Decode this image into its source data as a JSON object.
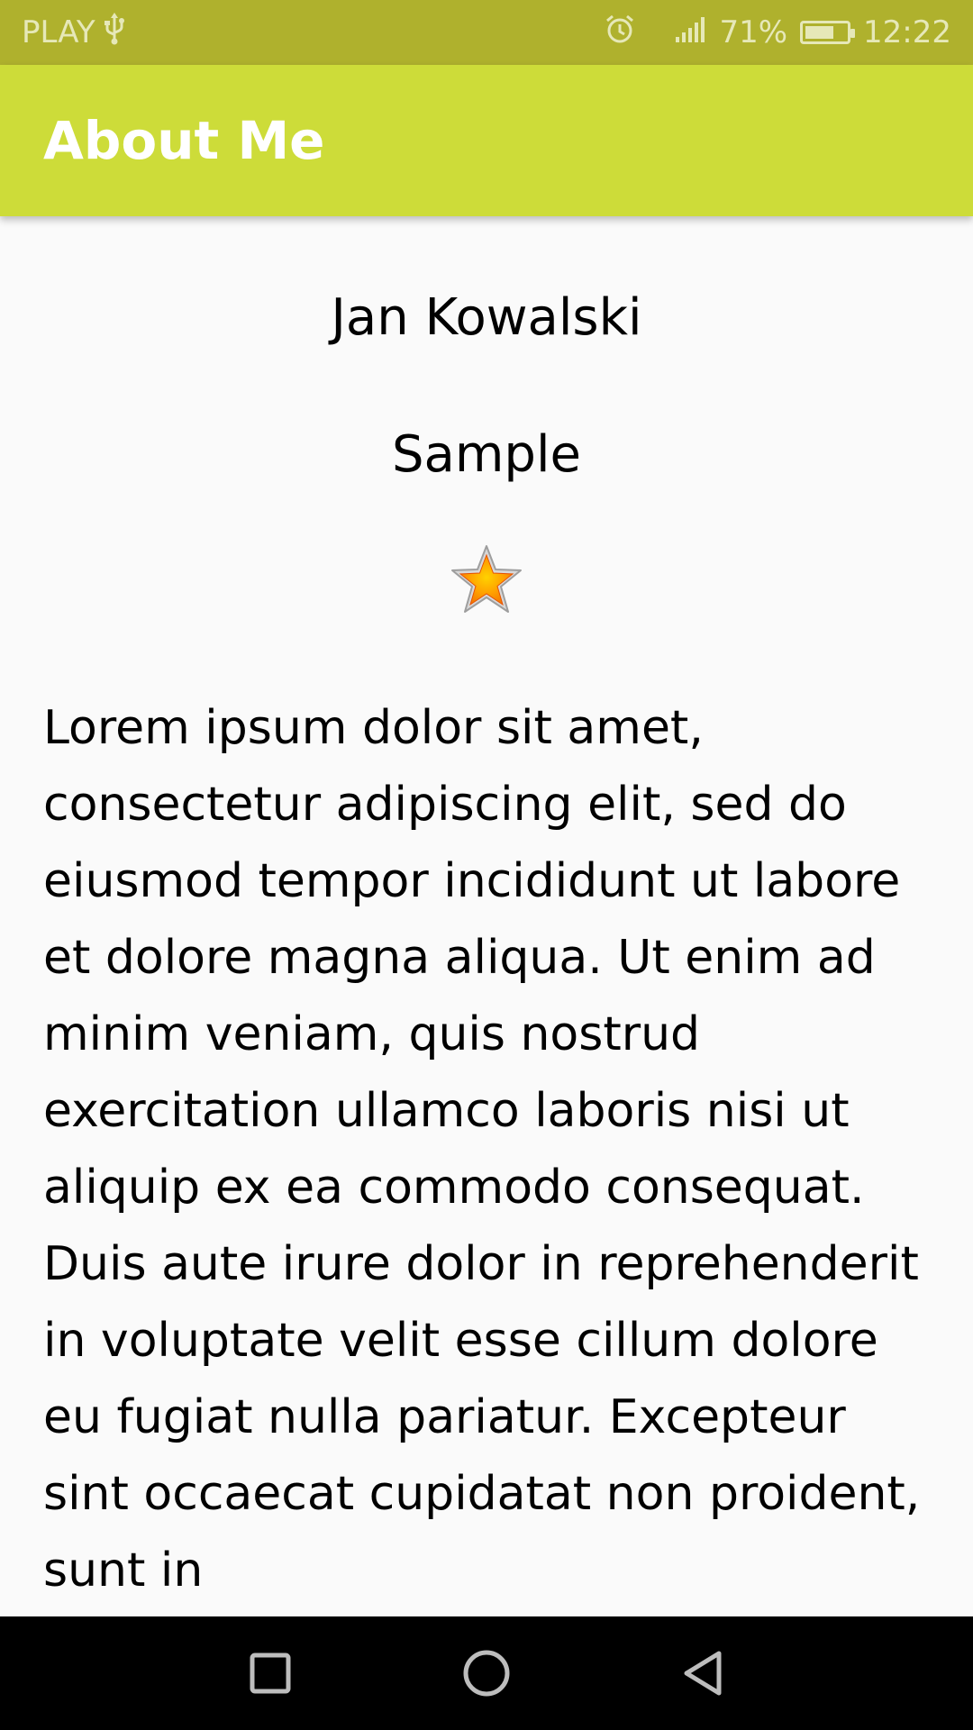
{
  "status_bar": {
    "carrier": "PLAY",
    "usb_icon": "usb-icon",
    "alarm_icon": "alarm-icon",
    "signal_icon": "signal-icon",
    "battery_percent": "71%",
    "battery_level": 0.71,
    "time": "12:22"
  },
  "app_bar": {
    "title": "About Me",
    "color": "#cddc39"
  },
  "profile": {
    "name": "Jan Kowalski",
    "nickname": "Sample",
    "star_icon": "star-icon",
    "bio": "Lorem ipsum dolor sit amet, consectetur adipiscing elit, sed do eiusmod tempor incididunt ut labore et dolore magna aliqua. Ut enim ad minim veniam, quis nostrud exercitation ullamco laboris nisi ut aliquip ex ea commodo consequat. Duis aute irure dolor in reprehenderit in voluptate velit esse cillum dolore eu fugiat nulla pariatur. Excepteur sint occaecat cupidatat non proident, sunt in"
  },
  "nav_bar": {
    "recents_icon": "recents-icon",
    "home_icon": "home-icon",
    "back_icon": "back-icon"
  },
  "colors": {
    "status_bar": "#afb12d",
    "app_bar": "#cddc39",
    "background": "#fafafa"
  }
}
